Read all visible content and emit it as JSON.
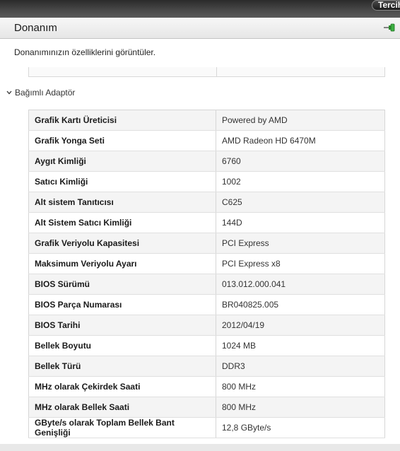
{
  "topbar": {
    "prefs_label": "Tercihler"
  },
  "header": {
    "title": "Donanım",
    "pin_icon": "pin-icon"
  },
  "description": "Donanımınızın özelliklerini görüntüler.",
  "section": {
    "title": "Bağımlı Adaptör",
    "icon": "chevron-down-icon"
  },
  "rows": [
    {
      "key": "Grafik Kartı Üreticisi",
      "value": "Powered by AMD"
    },
    {
      "key": "Grafik Yonga Seti",
      "value": "AMD Radeon HD 6470M"
    },
    {
      "key": "Aygıt Kimliği",
      "value": "6760"
    },
    {
      "key": "Satıcı Kimliği",
      "value": "1002"
    },
    {
      "key": "Alt sistem Tanıtıcısı",
      "value": "C625"
    },
    {
      "key": "Alt Sistem Satıcı Kimliği",
      "value": "144D"
    },
    {
      "key": "Grafik Veriyolu Kapasitesi",
      "value": "PCI Express"
    },
    {
      "key": "Maksimum Veriyolu Ayarı",
      "value": "PCI Express x8"
    },
    {
      "key": "BIOS Sürümü",
      "value": "013.012.000.041"
    },
    {
      "key": "BIOS Parça Numarası",
      "value": "BR040825.005"
    },
    {
      "key": "BIOS Tarihi",
      "value": "2012/04/19"
    },
    {
      "key": "Bellek Boyutu",
      "value": "1024 MB"
    },
    {
      "key": "Bellek Türü",
      "value": "DDR3"
    },
    {
      "key": "MHz olarak Çekirdek Saati",
      "value": "800 MHz"
    },
    {
      "key": "MHz olarak Bellek Saati",
      "value": "800 MHz"
    },
    {
      "key": "GByte/s olarak Toplam Bellek Bant Genişliği",
      "value": "12,8 GByte/s"
    }
  ]
}
